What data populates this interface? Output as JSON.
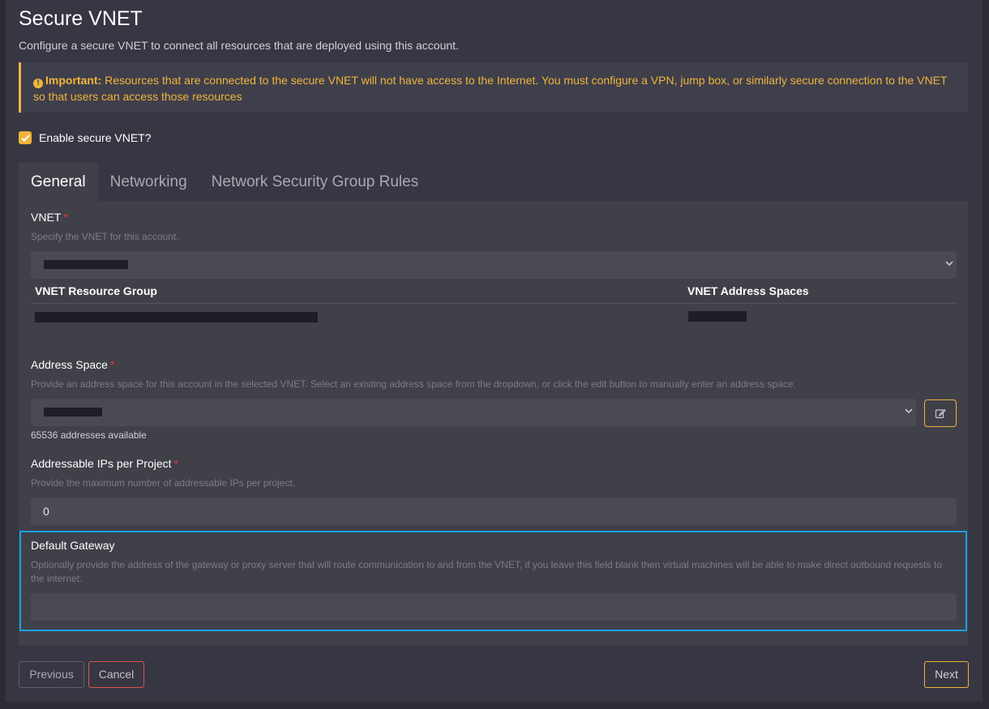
{
  "page": {
    "title": "Secure VNET",
    "subtitle": "Configure a secure VNET to connect all resources that are deployed using this account."
  },
  "alert": {
    "icon": "exclamation-circle-icon",
    "prefix": "Important:",
    "text": "Resources that are connected to the secure VNET will not have access to the Internet. You must configure a VPN, jump box, or similarly secure connection to the VNET so that users can access those resources"
  },
  "enable": {
    "label": "Enable secure VNET?",
    "checked": true
  },
  "tabs": [
    {
      "label": "General",
      "active": true
    },
    {
      "label": "Networking",
      "active": false
    },
    {
      "label": "Network Security Group Rules",
      "active": false
    }
  ],
  "vnet": {
    "label": "VNET",
    "help": "Specify the VNET for this account.",
    "required_mark": "*",
    "table": {
      "col1": "VNET Resource Group",
      "col2": "VNET Address Spaces"
    }
  },
  "address_space": {
    "label": "Address Space",
    "help": "Provide an address space for this account in the selected VNET. Select an existing address space from the dropdown, or click the edit button to manually enter an address space.",
    "available": "65536 addresses available",
    "required_mark": "*"
  },
  "ips": {
    "label": "Addressable IPs per Project",
    "help": "Provide the maximum number of addressable IPs per project.",
    "value": "0",
    "required_mark": "*"
  },
  "gateway": {
    "label": "Default Gateway",
    "help": "Optionally provide the address of the gateway or proxy server that will route communication to and from the VNET, if you leave this field blank then virtual machines will be able to make direct outbound requests to the internet.",
    "value": ""
  },
  "buttons": {
    "previous": "Previous",
    "cancel": "Cancel",
    "next": "Next"
  },
  "colors": {
    "accent": "#f0b43c",
    "highlight": "#1ba1e2",
    "danger": "#d9534f"
  }
}
